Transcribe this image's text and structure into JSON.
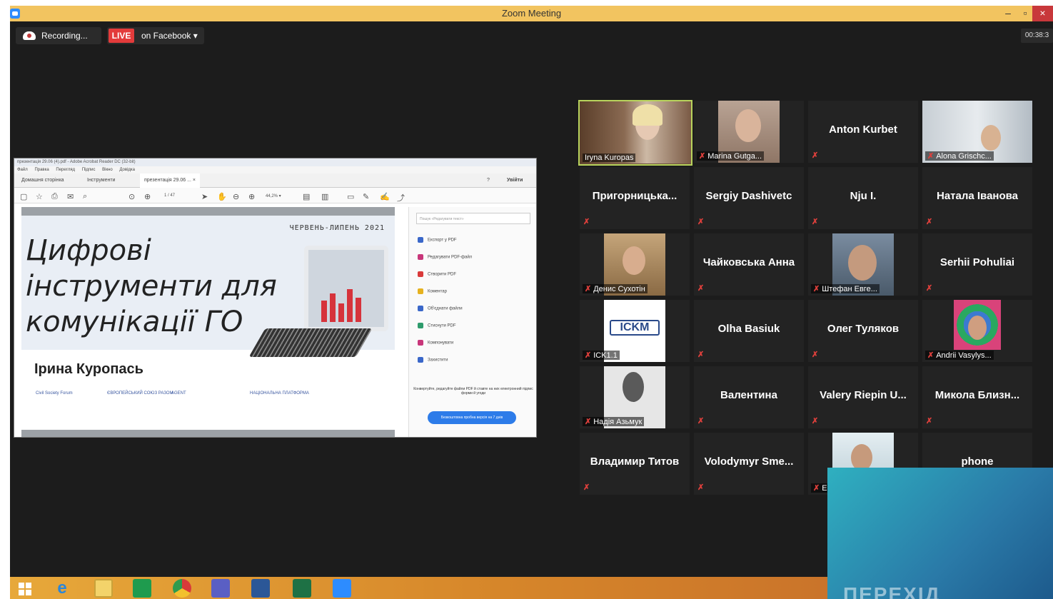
{
  "window": {
    "title": "Zoom Meeting"
  },
  "recording": {
    "label": "Recording..."
  },
  "live": {
    "badge": "LIVE",
    "destination": "on Facebook ▾"
  },
  "timer": {
    "value": "00:38:3"
  },
  "acrobat": {
    "title": "презентація 29.06 (4).pdf - Adobe Acrobat Reader DC (32-bit)",
    "menu": [
      "Файл",
      "Правка",
      "Перегляд",
      "Підпис",
      "Вікно",
      "Довідка"
    ],
    "tabs": [
      "Домашня сторінка",
      "Інструменти",
      "презентація 29.06 ... ×"
    ],
    "signin": "Увійти",
    "page_indicator": "1 / 47",
    "zoom": "44,2% ▾",
    "search_placeholder": "Пошук «Редагувати текст»",
    "panel_items": [
      {
        "label": "Експорт у PDF",
        "color": "#3a67c9"
      },
      {
        "label": "Редагувати PDF-файл",
        "color": "#c8367a"
      },
      {
        "label": "Створити PDF",
        "color": "#d93a3a"
      },
      {
        "label": "Коментар",
        "color": "#e6b21f"
      },
      {
        "label": "Об'єднати файли",
        "color": "#3a67c9"
      },
      {
        "label": "Стиснути PDF",
        "color": "#2e9b6c"
      },
      {
        "label": "Компонувати",
        "color": "#c8367a"
      },
      {
        "label": "Захистити",
        "color": "#3a67c9"
      }
    ],
    "promo": "Конвертуйте, редагуйте файли PDF й ставте на них електронний підпис форми й угоди",
    "trial": "Безкоштовна пробна версія на 7 днів"
  },
  "slide": {
    "date": "ЧЕРВЕНЬ-ЛИПЕНЬ 2021",
    "title": "Цифрові інструменти для комунікації ГО",
    "author": "Ірина Куропась",
    "logos": [
      "Civil Society Forum",
      "ЄВРОПЕЙСЬКИЙ СОЮЗ РАЗОМ",
      "AGENT",
      "НАЦІОНАЛЬНА ПЛАТФОРМА"
    ]
  },
  "participants": [
    {
      "name": "Iryna Kuropas",
      "video": true,
      "active": true
    },
    {
      "name": "Marina Gutga...",
      "video": true
    },
    {
      "name": "Anton Kurbet",
      "video": false
    },
    {
      "name": "Alona Grischc...",
      "video": true
    },
    {
      "name": "Пригорницька...",
      "video": false
    },
    {
      "name": "Sergiy Dashivetc",
      "video": false
    },
    {
      "name": "Nju I.",
      "video": false
    },
    {
      "name": "Натала Іванова",
      "video": false
    },
    {
      "name": "Денис Сухотін",
      "video": true
    },
    {
      "name": "Чайковська Анна",
      "video": false
    },
    {
      "name": "Штефан Евге...",
      "video": true
    },
    {
      "name": "Serhii Pohuliai",
      "video": false
    },
    {
      "name": "ICK1.1",
      "video": true,
      "logo": "ICKM"
    },
    {
      "name": "Olha Basiuk",
      "video": false
    },
    {
      "name": "Олег Туляков",
      "video": false
    },
    {
      "name": "Andrii Vasylys...",
      "video": true
    },
    {
      "name": "Надія Азьмук",
      "video": true
    },
    {
      "name": "Валентина",
      "video": false
    },
    {
      "name": "Valery Riepin U...",
      "video": false
    },
    {
      "name": "Микола Близн...",
      "video": false
    },
    {
      "name": "Владимир Титов",
      "video": false
    },
    {
      "name": "Volodymyr Sme...",
      "video": false
    },
    {
      "name": "Е",
      "video": true
    },
    {
      "name": "phone",
      "video": false
    }
  ],
  "overlay": {
    "text": "ПЕРЕХІД"
  },
  "taskbar": {
    "icons": [
      "windows-start-icon",
      "internet-explorer-icon",
      "file-explorer-icon",
      "store-icon",
      "chrome-icon",
      "teams-icon",
      "word-icon",
      "excel-icon",
      "zoom-icon"
    ]
  }
}
